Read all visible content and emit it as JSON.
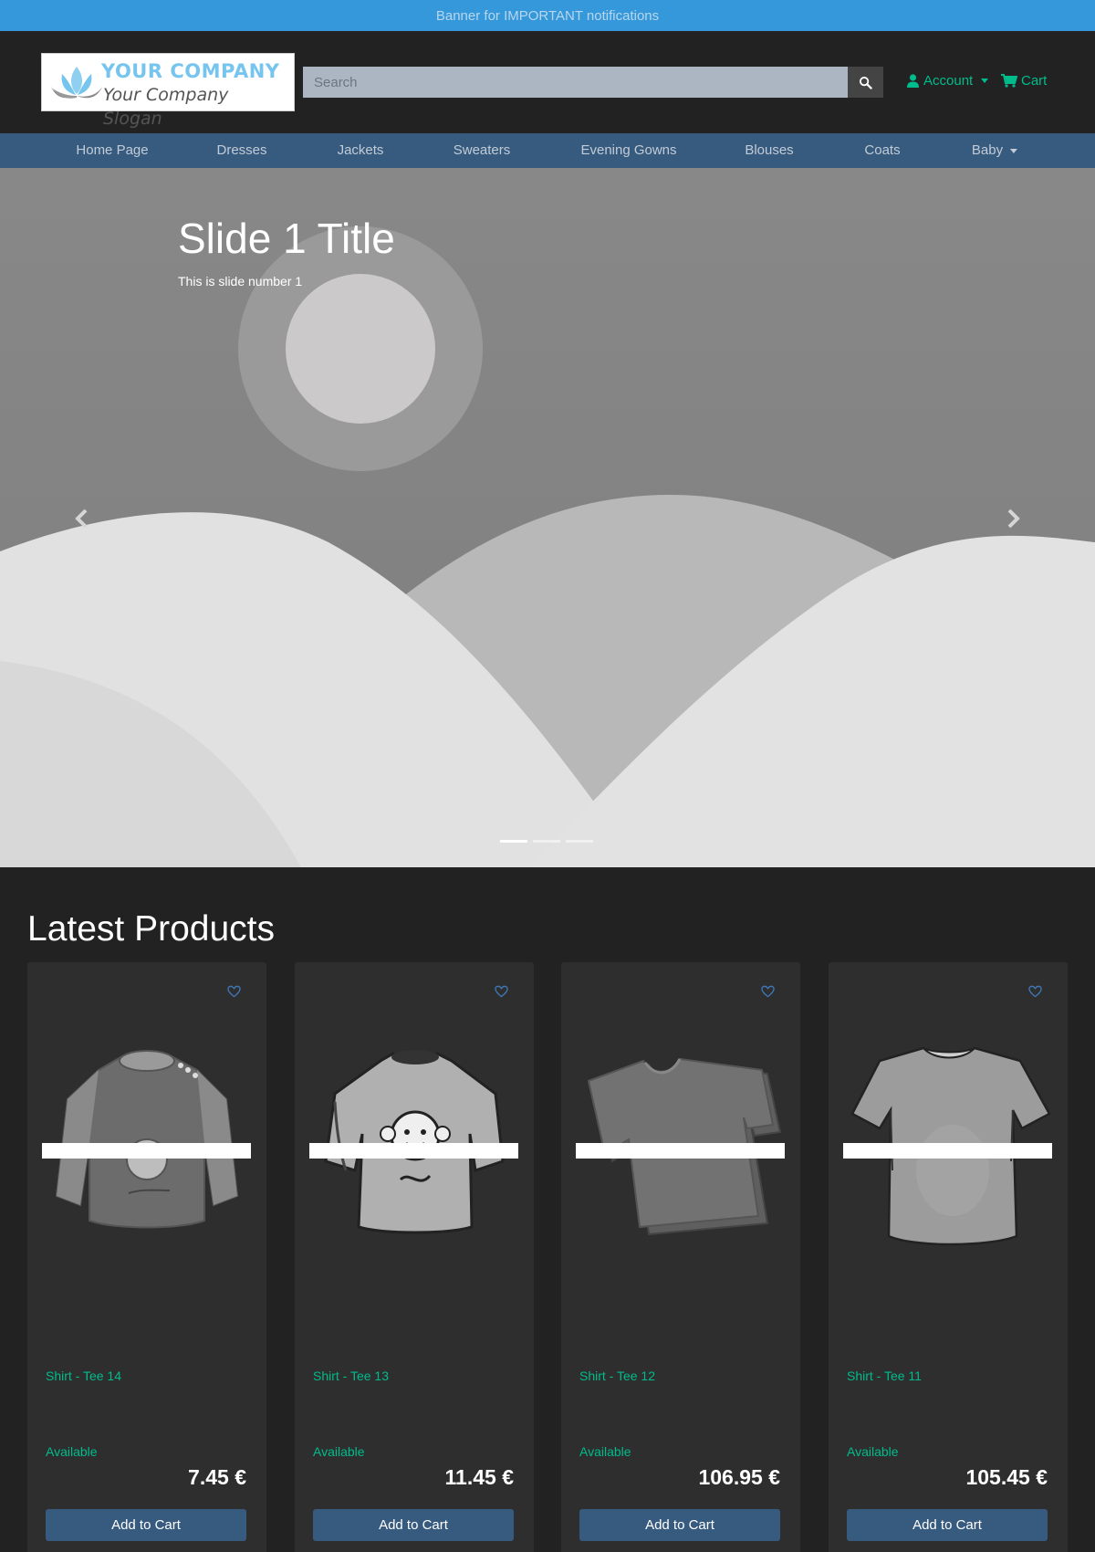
{
  "banner": {
    "text": "Banner for IMPORTANT notifications"
  },
  "header": {
    "logo": {
      "name": "YOUR COMPANY",
      "slogan": "Your Company Slogan"
    },
    "search": {
      "placeholder": "Search",
      "value": ""
    },
    "account_label": "Account",
    "cart_label": "Cart"
  },
  "nav": {
    "items": [
      {
        "label": "Home Page"
      },
      {
        "label": "Dresses"
      },
      {
        "label": "Jackets"
      },
      {
        "label": "Sweaters"
      },
      {
        "label": "Evening Gowns"
      },
      {
        "label": "Blouses"
      },
      {
        "label": "Coats"
      },
      {
        "label": "Baby",
        "has_dropdown": true
      }
    ]
  },
  "carousel": {
    "title": "Slide 1 Title",
    "caption": "This is slide number 1",
    "slide_count": 3,
    "active_index": 0
  },
  "products": {
    "heading": "Latest Products",
    "items": [
      {
        "name": "Shirt - Tee 14",
        "status": "Available",
        "price": "7.45 €",
        "button": "Add to Cart"
      },
      {
        "name": "Shirt - Tee 13",
        "status": "Available",
        "price": "11.45 €",
        "button": "Add to Cart"
      },
      {
        "name": "Shirt - Tee 12",
        "status": "Available",
        "price": "106.95 €",
        "button": "Add to Cart"
      },
      {
        "name": "Shirt - Tee 11",
        "status": "Available",
        "price": "105.45 €",
        "button": "Add to Cart"
      }
    ]
  },
  "colors": {
    "banner": "#3498db",
    "nav": "#375a7f",
    "accent": "#00bc8c",
    "background": "#222222",
    "card": "#2e2e2e"
  },
  "icons": {
    "search": "search-icon",
    "account": "user-icon",
    "cart": "cart-icon",
    "favorite": "heart-icon",
    "prev": "chevron-left-icon",
    "next": "chevron-right-icon"
  }
}
